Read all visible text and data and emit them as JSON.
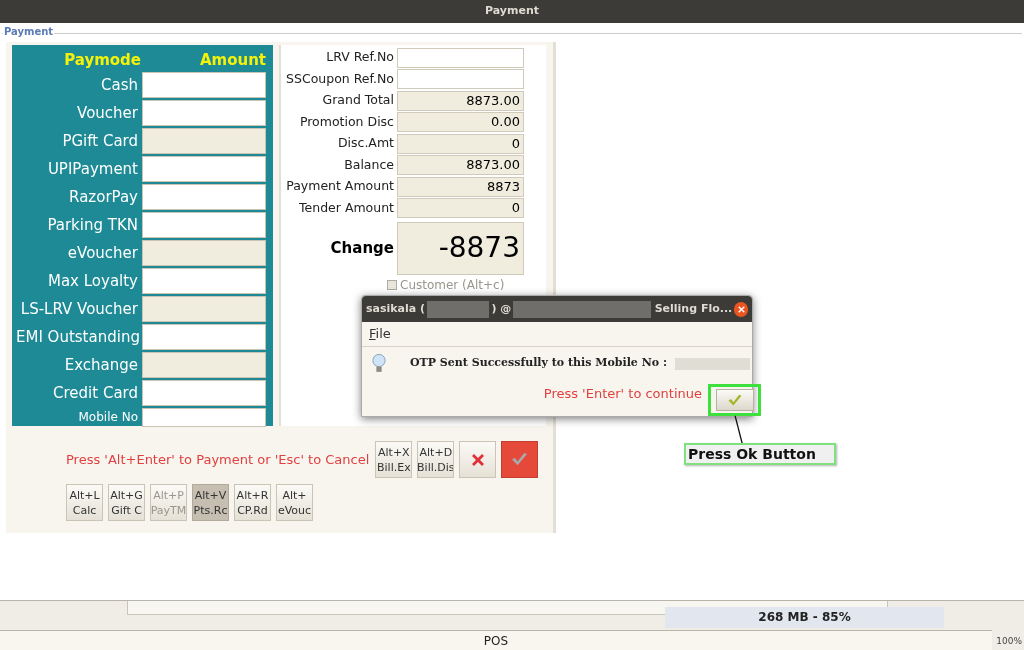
{
  "window": {
    "title": "Payment"
  },
  "group_label": "Payment",
  "paymodes": {
    "headers": [
      "Paymode",
      "Amount"
    ],
    "rows": [
      {
        "label": "Cash",
        "editable": true,
        "kind": "mode"
      },
      {
        "label": "Voucher",
        "editable": true,
        "kind": "mode"
      },
      {
        "label": "PGift Card",
        "editable": false,
        "kind": "mode"
      },
      {
        "label": "UPIPayment",
        "editable": true,
        "kind": "mode"
      },
      {
        "label": "RazorPay",
        "editable": true,
        "kind": "mode"
      },
      {
        "label": "Parking TKN",
        "editable": true,
        "kind": "mode"
      },
      {
        "label": "eVoucher",
        "editable": false,
        "kind": "mode"
      },
      {
        "label": "Max Loyalty",
        "editable": true,
        "kind": "mode"
      },
      {
        "label": "LS-LRV Voucher",
        "editable": false,
        "kind": "mode"
      },
      {
        "label": "EMI Outstanding",
        "editable": true,
        "kind": "mode"
      },
      {
        "label": "Exchange",
        "editable": false,
        "kind": "mode"
      },
      {
        "label": "Credit Card",
        "editable": true,
        "kind": "mode"
      },
      {
        "label": "Mobile No",
        "editable": true,
        "kind": "small"
      }
    ]
  },
  "summary": [
    {
      "label": "LRV Ref.No",
      "editable": true
    },
    {
      "label": "SSCoupon Ref.No",
      "editable": true
    },
    {
      "label": "Grand Total",
      "value": "8873.00",
      "editable": false
    },
    {
      "label": "Promotion Disc",
      "value": "0.00",
      "editable": false
    },
    {
      "label": "Disc.Amt",
      "value": "0",
      "editable": false
    },
    {
      "label": "Balance",
      "value": "8873.00",
      "editable": false
    },
    {
      "label": "Payment Amount",
      "value": "8873",
      "editable": false
    },
    {
      "label": "Tender Amount",
      "value": "0",
      "editable": false
    }
  ],
  "change": {
    "label": "Change",
    "value": "-8873"
  },
  "customer_checkbox": {
    "label": "Customer (Alt+c)",
    "checked": false,
    "disabled": true
  },
  "hint": "Press 'Alt+Enter' to Payment or 'Esc' to Cancel",
  "action_buttons": [
    {
      "kind": "shortcut",
      "lines": [
        "Alt+X",
        "Bill.Ex"
      ]
    },
    {
      "kind": "shortcut",
      "lines": [
        "Alt+D",
        "Bill.Dis"
      ]
    },
    {
      "kind": "cancel"
    },
    {
      "kind": "confirm"
    }
  ],
  "shortcut_buttons": [
    {
      "lines": [
        "Alt+L",
        "Calc"
      ],
      "disabled": false,
      "selected": false
    },
    {
      "lines": [
        "Alt+G",
        "Gift C"
      ],
      "disabled": false,
      "selected": false
    },
    {
      "lines": [
        "Alt+P",
        "PayTM"
      ],
      "disabled": true,
      "selected": false
    },
    {
      "lines": [
        "Alt+V",
        "Pts.Rc"
      ],
      "disabled": false,
      "selected": true
    },
    {
      "lines": [
        "Alt+R",
        "CP.Rd"
      ],
      "disabled": false,
      "selected": false
    },
    {
      "lines": [
        "Alt+",
        "eVouc"
      ],
      "disabled": false,
      "selected": false
    }
  ],
  "dialog": {
    "title_parts": [
      "sasikala (",
      ") @",
      "Selling Flo..."
    ],
    "menu": "File",
    "message": "OTP Sent Successfully to this Mobile No :",
    "prompt": "Press 'Enter' to continue"
  },
  "callout": "Press Ok Button",
  "memory": "268 MB - 85%",
  "status": "POS",
  "zoom": "100%"
}
